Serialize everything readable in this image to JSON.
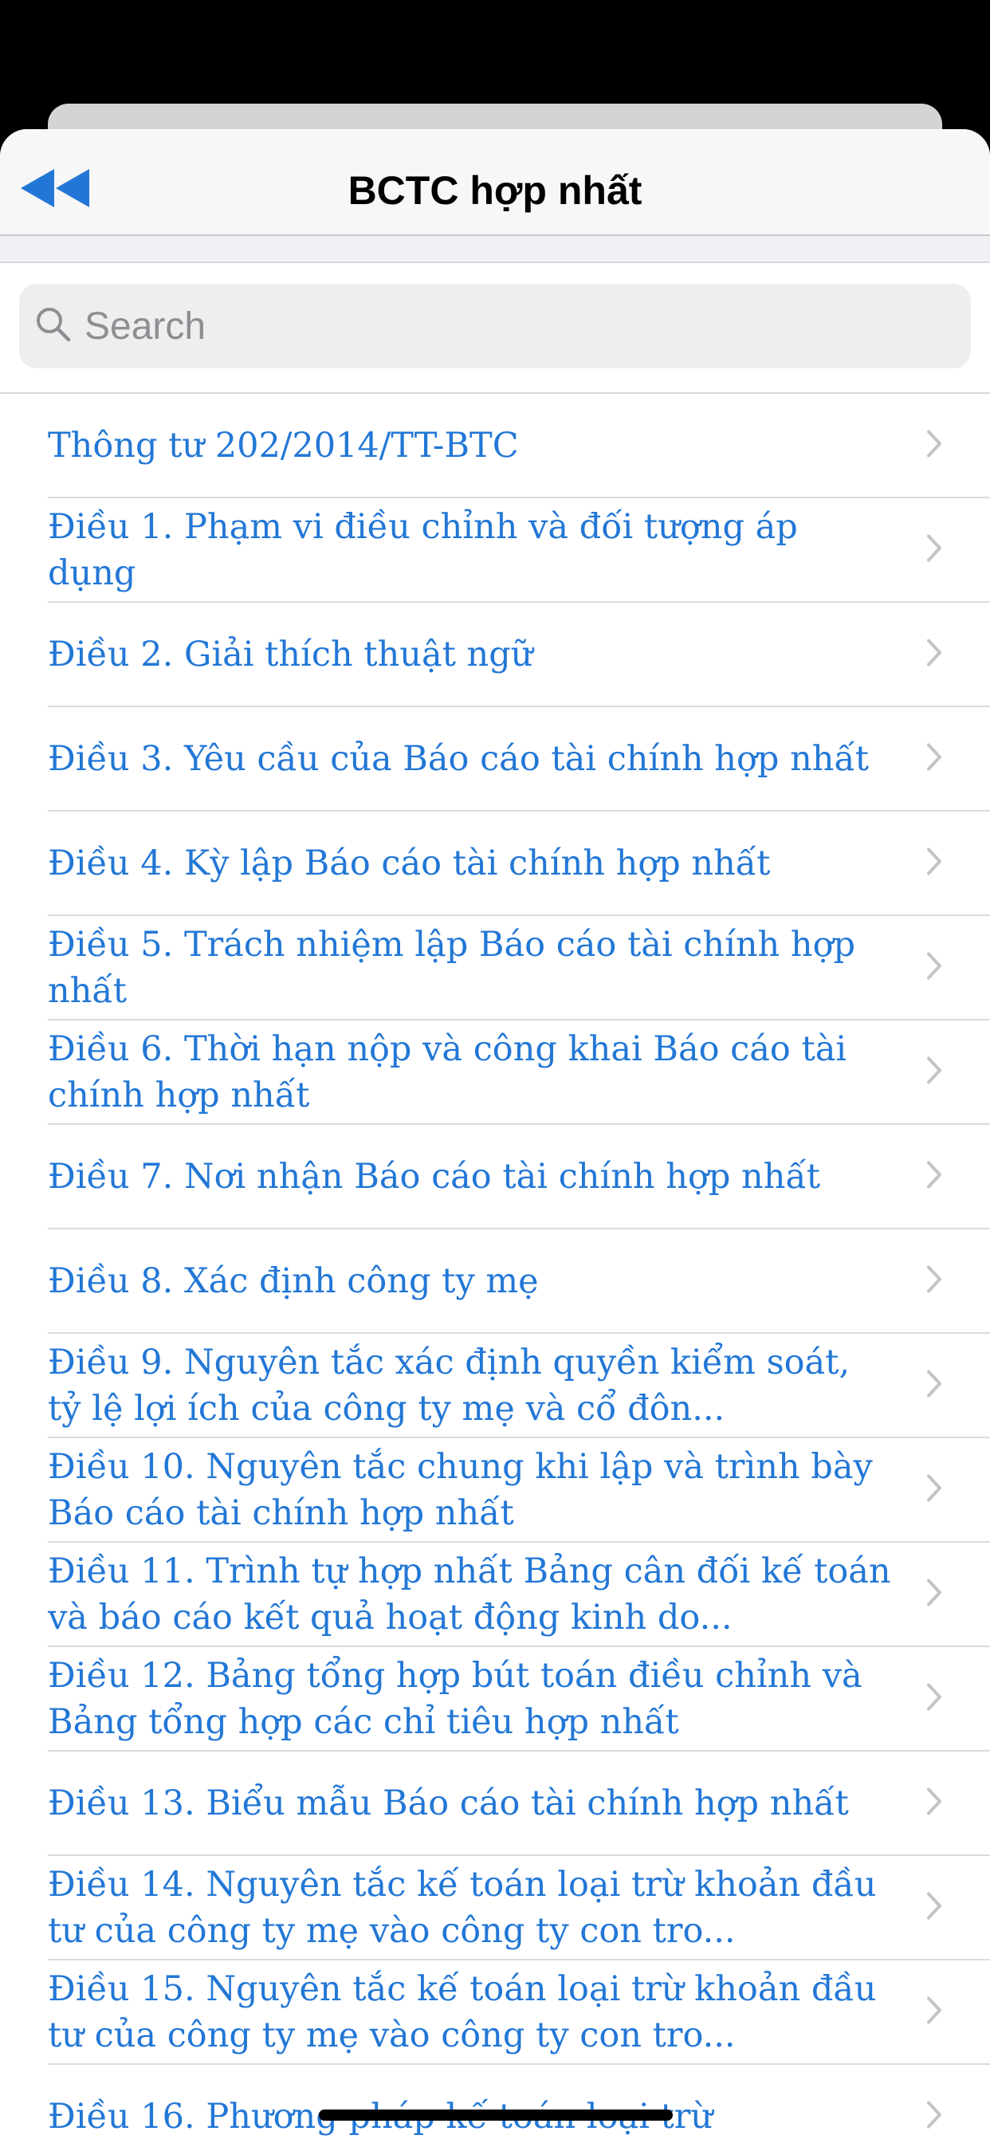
{
  "header": {
    "title": "BCTC hợp nhất",
    "back_icon": "double-chevron-left-icon"
  },
  "search": {
    "placeholder": "Search",
    "value": ""
  },
  "colors": {
    "accent": "#2277d6",
    "nav_background": "#f7f7f7",
    "search_background": "#eeeeef"
  },
  "items": [
    {
      "label": "Thông tư 202/2014/TT-BTC"
    },
    {
      "label": "Điều 1. Phạm vi điều chỉnh và đối tượng áp dụng"
    },
    {
      "label": "Điều 2. Giải thích thuật ngữ"
    },
    {
      "label": "Điều 3. Yêu cầu của Báo cáo tài chính hợp nhất"
    },
    {
      "label": "Điều 4. Kỳ lập Báo cáo tài chính hợp nhất"
    },
    {
      "label": "Điều 5. Trách nhiệm lập Báo cáo tài chính hợp nhất"
    },
    {
      "label": "Điều 6. Thời hạn nộp và công khai Báo cáo tài chính hợp nhất"
    },
    {
      "label": "Điều 7. Nơi nhận Báo cáo tài chính hợp nhất"
    },
    {
      "label": "Điều 8. Xác định công ty mẹ"
    },
    {
      "label": "Điều 9. Nguyên tắc xác định quyền kiểm soát, tỷ lệ lợi ích của công ty mẹ và cổ đôn..."
    },
    {
      "label": "Điều 10. Nguyên tắc chung khi lập và trình bày Báo cáo tài chính hợp nhất"
    },
    {
      "label": "Điều 11. Trình tự hợp nhất Bảng cân đối kế toán và báo cáo kết quả hoạt động kinh do..."
    },
    {
      "label": "Điều 12. Bảng tổng hợp bút toán điều chỉnh và Bảng tổng hợp các chỉ tiêu hợp nhất"
    },
    {
      "label": "Điều 13. Biểu mẫu Báo cáo tài chính hợp nhất"
    },
    {
      "label": "Điều 14. Nguyên tắc kế toán loại trừ khoản đầu tư của công ty mẹ vào công ty con tro..."
    },
    {
      "label": "Điều 15. Nguyên tắc kế toán loại trừ khoản đầu tư của công ty mẹ vào công ty con tro..."
    },
    {
      "label": "Điều 16. Phương pháp kế toán loại trừ"
    }
  ]
}
